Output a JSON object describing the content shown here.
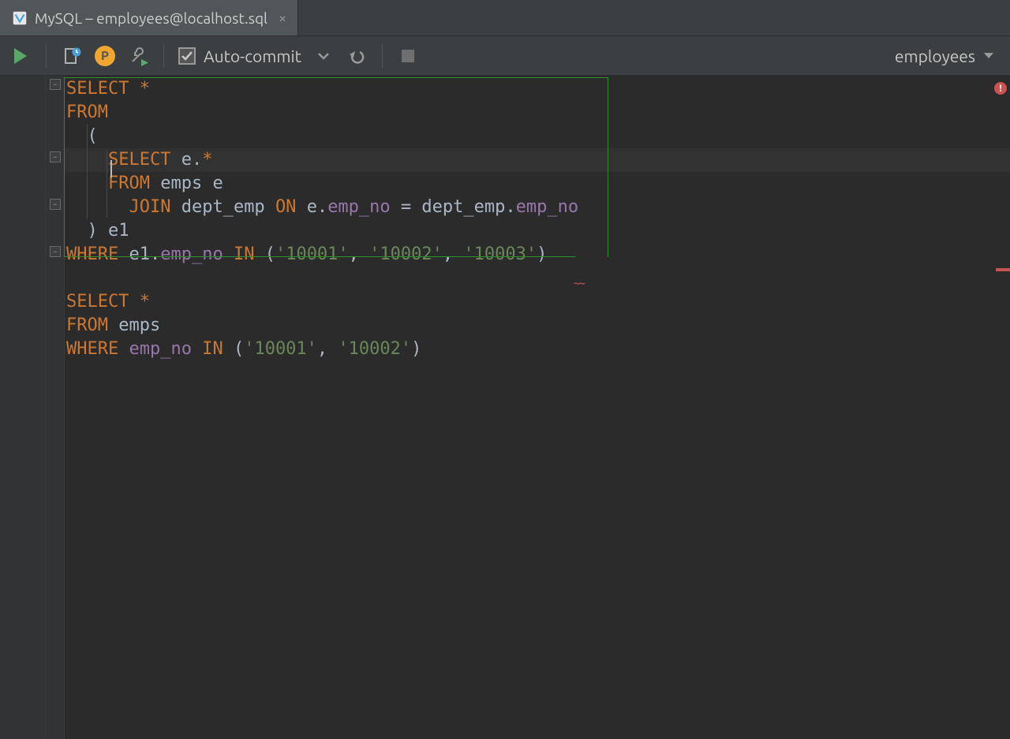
{
  "tab": {
    "title": "MySQL – employees@localhost.sql",
    "icon": "database-icon"
  },
  "toolbar": {
    "autocommit_label": "Auto-commit",
    "schema_label": "employees"
  },
  "code": {
    "lines": [
      [
        {
          "t": "kw",
          "v": "SELECT "
        },
        {
          "t": "star",
          "v": "*"
        }
      ],
      [
        {
          "t": "kw",
          "v": "FROM"
        }
      ],
      [
        {
          "t": "paren",
          "v": "  ("
        }
      ],
      [
        {
          "t": "id",
          "v": "    "
        },
        {
          "t": "kw",
          "v": "SELECT "
        },
        {
          "t": "id",
          "v": "e."
        },
        {
          "t": "star",
          "v": "*"
        }
      ],
      [
        {
          "t": "id",
          "v": "    "
        },
        {
          "t": "kw",
          "v": "FROM "
        },
        {
          "t": "id",
          "v": "emps e"
        }
      ],
      [
        {
          "t": "id",
          "v": "      "
        },
        {
          "t": "kw",
          "v": "JOIN "
        },
        {
          "t": "id",
          "v": "dept_emp "
        },
        {
          "t": "kw",
          "v": "ON "
        },
        {
          "t": "id",
          "v": "e."
        },
        {
          "t": "col",
          "v": "emp_no"
        },
        {
          "t": "id",
          "v": " = dept_emp."
        },
        {
          "t": "col",
          "v": "emp_no"
        }
      ],
      [
        {
          "t": "paren",
          "v": "  ) "
        },
        {
          "t": "id",
          "v": "e1"
        }
      ],
      [
        {
          "t": "kw",
          "v": "WHERE "
        },
        {
          "t": "id",
          "v": "e1."
        },
        {
          "t": "col",
          "v": "emp_no"
        },
        {
          "t": "kw",
          "v": " IN "
        },
        {
          "t": "paren",
          "v": "("
        },
        {
          "t": "str",
          "v": "'10001'"
        },
        {
          "t": "paren",
          "v": ", "
        },
        {
          "t": "str",
          "v": "'10002'"
        },
        {
          "t": "paren",
          "v": ", "
        },
        {
          "t": "str",
          "v": "'10003'"
        },
        {
          "t": "paren",
          "v": ")"
        }
      ],
      [
        {
          "t": "id",
          "v": ""
        }
      ],
      [
        {
          "t": "kw",
          "v": "SELECT "
        },
        {
          "t": "star",
          "v": "*"
        }
      ],
      [
        {
          "t": "kw",
          "v": "FROM "
        },
        {
          "t": "id",
          "v": "emps"
        }
      ],
      [
        {
          "t": "kw",
          "v": "WHERE "
        },
        {
          "t": "col",
          "v": "emp_no"
        },
        {
          "t": "kw",
          "v": " IN "
        },
        {
          "t": "paren",
          "v": "("
        },
        {
          "t": "str",
          "v": "'10001'"
        },
        {
          "t": "paren",
          "v": ", "
        },
        {
          "t": "str",
          "v": "'10002'"
        },
        {
          "t": "paren",
          "v": ")"
        }
      ]
    ],
    "caret_line_index": 3
  },
  "colors": {
    "keyword": "#cc7832",
    "identifier": "#a9b7c6",
    "column": "#9876aa",
    "string": "#6a8759",
    "selection_border": "#2f8f2f",
    "error": "#c75450"
  }
}
